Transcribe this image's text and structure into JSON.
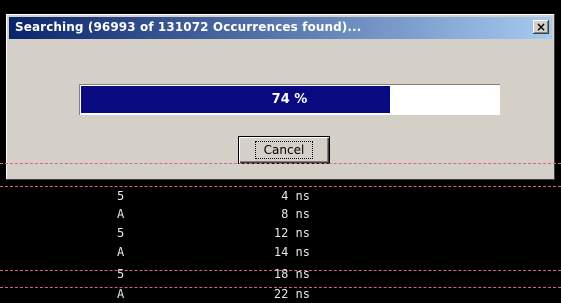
{
  "dialog": {
    "title": "Searching (96993 of 131072 Occurrences found)...",
    "close_label": "×",
    "progress_percent": 74,
    "progress_text": "74 %",
    "cancel_label": "Cancel"
  },
  "rows": [
    {
      "value": "5",
      "time": "4 ns"
    },
    {
      "value": "A",
      "time": "8 ns"
    },
    {
      "value": "5",
      "time": "12 ns"
    },
    {
      "value": "A",
      "time": "14 ns"
    },
    {
      "value": "5",
      "time": "18 ns"
    },
    {
      "value": "A",
      "time": "22 ns"
    }
  ],
  "colors": {
    "separator": "#e06080",
    "progress_fill": "#0a0a80"
  }
}
